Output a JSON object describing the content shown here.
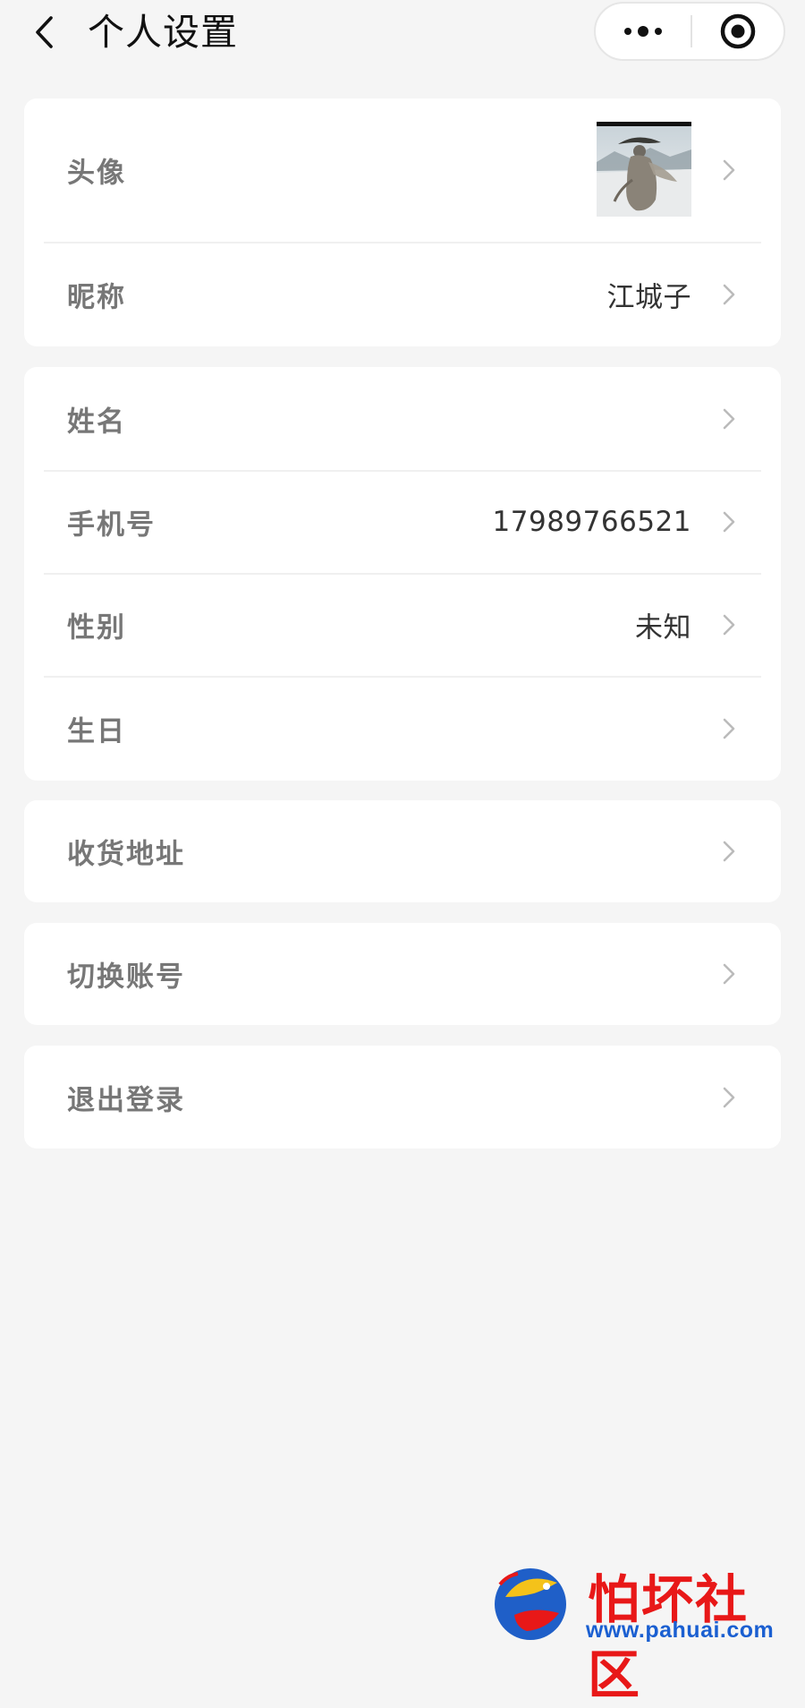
{
  "header": {
    "title": "个人设置"
  },
  "profile_card": {
    "avatar_label": "头像",
    "nickname_label": "昵称",
    "nickname_value": "江城子"
  },
  "info_card": {
    "name_label": "姓名",
    "name_value": "",
    "phone_label": "手机号",
    "phone_value": "17989766521",
    "gender_label": "性别",
    "gender_value": "未知",
    "birthday_label": "生日",
    "birthday_value": ""
  },
  "address_card": {
    "label": "收货地址"
  },
  "switch_card": {
    "label": "切换账号"
  },
  "logout_card": {
    "label": "退出登录"
  },
  "watermark": {
    "text": "怕坏社区",
    "url": "www.pahuai.com"
  },
  "colors": {
    "background": "#f5f5f5",
    "card": "#ffffff",
    "label": "#777777",
    "value": "#333333",
    "arrow": "#bbbbbb",
    "watermark_red": "#e81818",
    "watermark_blue": "#1a5fd1"
  },
  "icons": {
    "back": "chevron-left-icon",
    "more": "more-dots-icon",
    "close": "target-circle-icon",
    "arrow": "chevron-right-icon"
  }
}
